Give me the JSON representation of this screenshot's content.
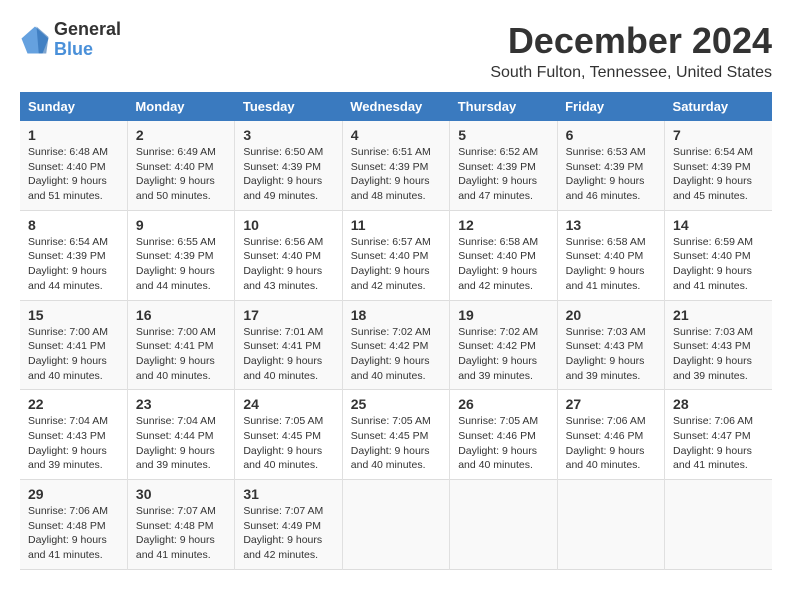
{
  "logo": {
    "general": "General",
    "blue": "Blue"
  },
  "title": "December 2024",
  "subtitle": "South Fulton, Tennessee, United States",
  "columns": [
    "Sunday",
    "Monday",
    "Tuesday",
    "Wednesday",
    "Thursday",
    "Friday",
    "Saturday"
  ],
  "weeks": [
    [
      {
        "day": "1",
        "sunrise": "Sunrise: 6:48 AM",
        "sunset": "Sunset: 4:40 PM",
        "daylight": "Daylight: 9 hours and 51 minutes."
      },
      {
        "day": "2",
        "sunrise": "Sunrise: 6:49 AM",
        "sunset": "Sunset: 4:40 PM",
        "daylight": "Daylight: 9 hours and 50 minutes."
      },
      {
        "day": "3",
        "sunrise": "Sunrise: 6:50 AM",
        "sunset": "Sunset: 4:39 PM",
        "daylight": "Daylight: 9 hours and 49 minutes."
      },
      {
        "day": "4",
        "sunrise": "Sunrise: 6:51 AM",
        "sunset": "Sunset: 4:39 PM",
        "daylight": "Daylight: 9 hours and 48 minutes."
      },
      {
        "day": "5",
        "sunrise": "Sunrise: 6:52 AM",
        "sunset": "Sunset: 4:39 PM",
        "daylight": "Daylight: 9 hours and 47 minutes."
      },
      {
        "day": "6",
        "sunrise": "Sunrise: 6:53 AM",
        "sunset": "Sunset: 4:39 PM",
        "daylight": "Daylight: 9 hours and 46 minutes."
      },
      {
        "day": "7",
        "sunrise": "Sunrise: 6:54 AM",
        "sunset": "Sunset: 4:39 PM",
        "daylight": "Daylight: 9 hours and 45 minutes."
      }
    ],
    [
      {
        "day": "8",
        "sunrise": "Sunrise: 6:54 AM",
        "sunset": "Sunset: 4:39 PM",
        "daylight": "Daylight: 9 hours and 44 minutes."
      },
      {
        "day": "9",
        "sunrise": "Sunrise: 6:55 AM",
        "sunset": "Sunset: 4:39 PM",
        "daylight": "Daylight: 9 hours and 44 minutes."
      },
      {
        "day": "10",
        "sunrise": "Sunrise: 6:56 AM",
        "sunset": "Sunset: 4:40 PM",
        "daylight": "Daylight: 9 hours and 43 minutes."
      },
      {
        "day": "11",
        "sunrise": "Sunrise: 6:57 AM",
        "sunset": "Sunset: 4:40 PM",
        "daylight": "Daylight: 9 hours and 42 minutes."
      },
      {
        "day": "12",
        "sunrise": "Sunrise: 6:58 AM",
        "sunset": "Sunset: 4:40 PM",
        "daylight": "Daylight: 9 hours and 42 minutes."
      },
      {
        "day": "13",
        "sunrise": "Sunrise: 6:58 AM",
        "sunset": "Sunset: 4:40 PM",
        "daylight": "Daylight: 9 hours and 41 minutes."
      },
      {
        "day": "14",
        "sunrise": "Sunrise: 6:59 AM",
        "sunset": "Sunset: 4:40 PM",
        "daylight": "Daylight: 9 hours and 41 minutes."
      }
    ],
    [
      {
        "day": "15",
        "sunrise": "Sunrise: 7:00 AM",
        "sunset": "Sunset: 4:41 PM",
        "daylight": "Daylight: 9 hours and 40 minutes."
      },
      {
        "day": "16",
        "sunrise": "Sunrise: 7:00 AM",
        "sunset": "Sunset: 4:41 PM",
        "daylight": "Daylight: 9 hours and 40 minutes."
      },
      {
        "day": "17",
        "sunrise": "Sunrise: 7:01 AM",
        "sunset": "Sunset: 4:41 PM",
        "daylight": "Daylight: 9 hours and 40 minutes."
      },
      {
        "day": "18",
        "sunrise": "Sunrise: 7:02 AM",
        "sunset": "Sunset: 4:42 PM",
        "daylight": "Daylight: 9 hours and 40 minutes."
      },
      {
        "day": "19",
        "sunrise": "Sunrise: 7:02 AM",
        "sunset": "Sunset: 4:42 PM",
        "daylight": "Daylight: 9 hours and 39 minutes."
      },
      {
        "day": "20",
        "sunrise": "Sunrise: 7:03 AM",
        "sunset": "Sunset: 4:43 PM",
        "daylight": "Daylight: 9 hours and 39 minutes."
      },
      {
        "day": "21",
        "sunrise": "Sunrise: 7:03 AM",
        "sunset": "Sunset: 4:43 PM",
        "daylight": "Daylight: 9 hours and 39 minutes."
      }
    ],
    [
      {
        "day": "22",
        "sunrise": "Sunrise: 7:04 AM",
        "sunset": "Sunset: 4:43 PM",
        "daylight": "Daylight: 9 hours and 39 minutes."
      },
      {
        "day": "23",
        "sunrise": "Sunrise: 7:04 AM",
        "sunset": "Sunset: 4:44 PM",
        "daylight": "Daylight: 9 hours and 39 minutes."
      },
      {
        "day": "24",
        "sunrise": "Sunrise: 7:05 AM",
        "sunset": "Sunset: 4:45 PM",
        "daylight": "Daylight: 9 hours and 40 minutes."
      },
      {
        "day": "25",
        "sunrise": "Sunrise: 7:05 AM",
        "sunset": "Sunset: 4:45 PM",
        "daylight": "Daylight: 9 hours and 40 minutes."
      },
      {
        "day": "26",
        "sunrise": "Sunrise: 7:05 AM",
        "sunset": "Sunset: 4:46 PM",
        "daylight": "Daylight: 9 hours and 40 minutes."
      },
      {
        "day": "27",
        "sunrise": "Sunrise: 7:06 AM",
        "sunset": "Sunset: 4:46 PM",
        "daylight": "Daylight: 9 hours and 40 minutes."
      },
      {
        "day": "28",
        "sunrise": "Sunrise: 7:06 AM",
        "sunset": "Sunset: 4:47 PM",
        "daylight": "Daylight: 9 hours and 41 minutes."
      }
    ],
    [
      {
        "day": "29",
        "sunrise": "Sunrise: 7:06 AM",
        "sunset": "Sunset: 4:48 PM",
        "daylight": "Daylight: 9 hours and 41 minutes."
      },
      {
        "day": "30",
        "sunrise": "Sunrise: 7:07 AM",
        "sunset": "Sunset: 4:48 PM",
        "daylight": "Daylight: 9 hours and 41 minutes."
      },
      {
        "day": "31",
        "sunrise": "Sunrise: 7:07 AM",
        "sunset": "Sunset: 4:49 PM",
        "daylight": "Daylight: 9 hours and 42 minutes."
      },
      null,
      null,
      null,
      null
    ]
  ]
}
